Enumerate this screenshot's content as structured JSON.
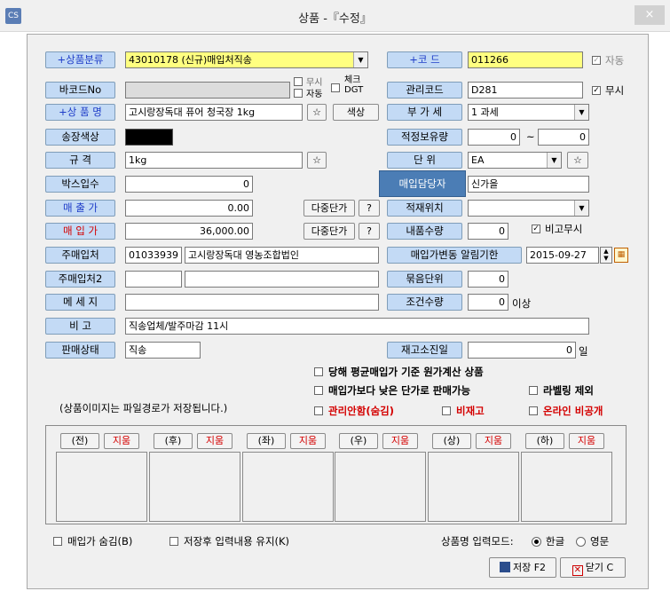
{
  "window": {
    "title": "상품 -『수정』",
    "close": "×",
    "icon": "CS"
  },
  "labels": {
    "category": "+상품분류",
    "code": "+코    드",
    "barcode": "바코드No",
    "mgmt_code": "관리코드",
    "product_name": "+상 품 명",
    "vat": "부 가 세",
    "invoice_color": "송장색상",
    "proper_stock": "적정보유량",
    "spec": "규    격",
    "unit": "단    위",
    "box_qty": "박스입수",
    "sales_price": "매 출 가",
    "storage_loc": "적재위치",
    "purchase_price": "매 입 가",
    "delivery_qty": "내품수량",
    "main_supplier": "주매입처",
    "price_change_alert": "매입가변동 알림기한",
    "main_supplier2": "주매입처2",
    "bundle_unit": "묶음단위",
    "message": "메 세 지",
    "condition_qty": "조건수량",
    "remarks": "비    고",
    "sale_status": "판매상태",
    "stock_exhaust_days": "재고소진일"
  },
  "fields": {
    "category": "43010178 (신규)매입처직송",
    "code": "011266",
    "barcode": "",
    "mgmt_code": "D281",
    "product_name": "고시랑장독대 퓨어 청국장 1kg",
    "vat": "1 과세",
    "proper_stock_min": "0",
    "proper_stock_max": "0",
    "proper_stock_sep": "~",
    "spec": "1kg",
    "unit": "EA",
    "box_qty": "0",
    "buyer_name": "신가을",
    "sales_price": "0.00",
    "storage_loc": "",
    "purchase_price": "36,000.00",
    "delivery_qty": "0",
    "supplier_code": "01033939",
    "supplier_name": "고시랑장독대 영농조합법인",
    "price_alert_date": "2015-09-27",
    "main_supplier2_code": "",
    "main_supplier2_name": "",
    "bundle_unit": "0",
    "message": "",
    "condition_qty": "0",
    "condition_suffix": "이상",
    "remarks": "직송업체/발주마감 11시",
    "sale_status": "직송",
    "stock_exhaust_days": "0",
    "days_suffix": "일"
  },
  "checks": {
    "auto": "자동",
    "ignore": "무시",
    "auto2": "자동",
    "check_dgt": "체크 DGT",
    "vat_ignore": "무시",
    "compare_ignore": "비고무시",
    "avg_cost": "당해 평균매입가 기준 원가계산 상품",
    "below_price": "매입가보다 낮은 단가로 판매가능",
    "label_excl": "라벨링 제외",
    "mgmt_hidden": "관리안함(숨김)",
    "non_stock": "비재고",
    "online_private": "온라인 비공개",
    "hide_purchase": "매입가 숨김(B)",
    "keep_input": "저장후 입력내용 유지(K)"
  },
  "buttons": {
    "star": "☆",
    "color": "색상",
    "multi_price": "다중단가",
    "help": "?",
    "save": "저장 F2",
    "close": "닫기 C"
  },
  "tooltip": "매입담당자",
  "image_note": "(상품이미지는 파일경로가 저장됩니다.)",
  "image_slots": [
    {
      "label": "(전)",
      "delete": "지움"
    },
    {
      "label": "(후)",
      "delete": "지움"
    },
    {
      "label": "(좌)",
      "delete": "지움"
    },
    {
      "label": "(우)",
      "delete": "지움"
    },
    {
      "label": "(상)",
      "delete": "지움"
    },
    {
      "label": "(하)",
      "delete": "지움"
    }
  ],
  "input_mode": {
    "label": "상품명 입력모드:",
    "korean": "한글",
    "english": "영문",
    "selected": "한글"
  },
  "colors": {
    "label_bg": "#c3daf5",
    "highlight": "#ffff80",
    "accent_red": "#d40000",
    "label_blue": "#1e3cc8",
    "tooltip_bg": "#4b7db5"
  }
}
